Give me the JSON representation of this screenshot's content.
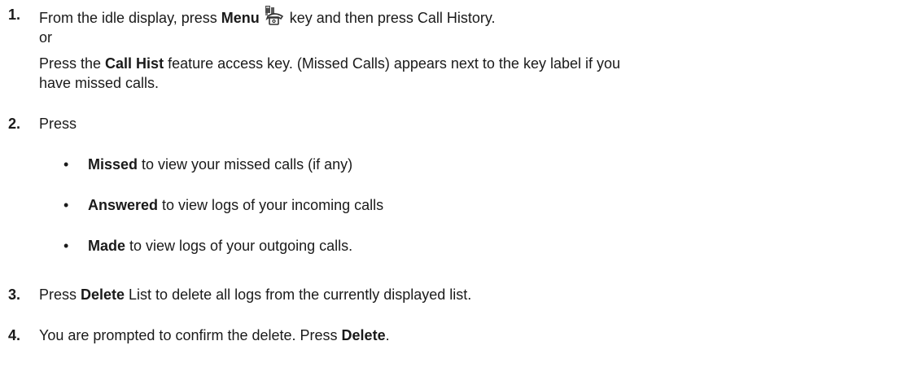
{
  "steps": [
    {
      "number": "1.",
      "text_a": "From the idle display, press ",
      "bold_a": "Menu",
      "text_b": " key and then press Call History.",
      "or_label": "or",
      "text_c": "Press the ",
      "bold_c": "Call Hist",
      "text_d": " feature access key. (Missed Calls) appears next to the key label if you",
      "text_e": "have missed calls."
    },
    {
      "number": "2.",
      "text": "Press",
      "bullets": [
        {
          "bold": "Missed",
          "text": " to view your missed calls (if any)"
        },
        {
          "bold": "Answered",
          "text": " to view logs of your incoming calls"
        },
        {
          "bold": "Made",
          "text": " to view logs of your outgoing calls."
        }
      ]
    },
    {
      "number": "3.",
      "text_a": "Press ",
      "bold_a": "Delete",
      "text_b": " List to delete all logs from the currently displayed list."
    },
    {
      "number": "4.",
      "text_a": "You are prompted to confirm the delete. Press ",
      "bold_a": "Delete",
      "text_b": "."
    }
  ],
  "icons": {
    "menu_key": "menu-phone-icon"
  },
  "bullet_glyph": "•"
}
